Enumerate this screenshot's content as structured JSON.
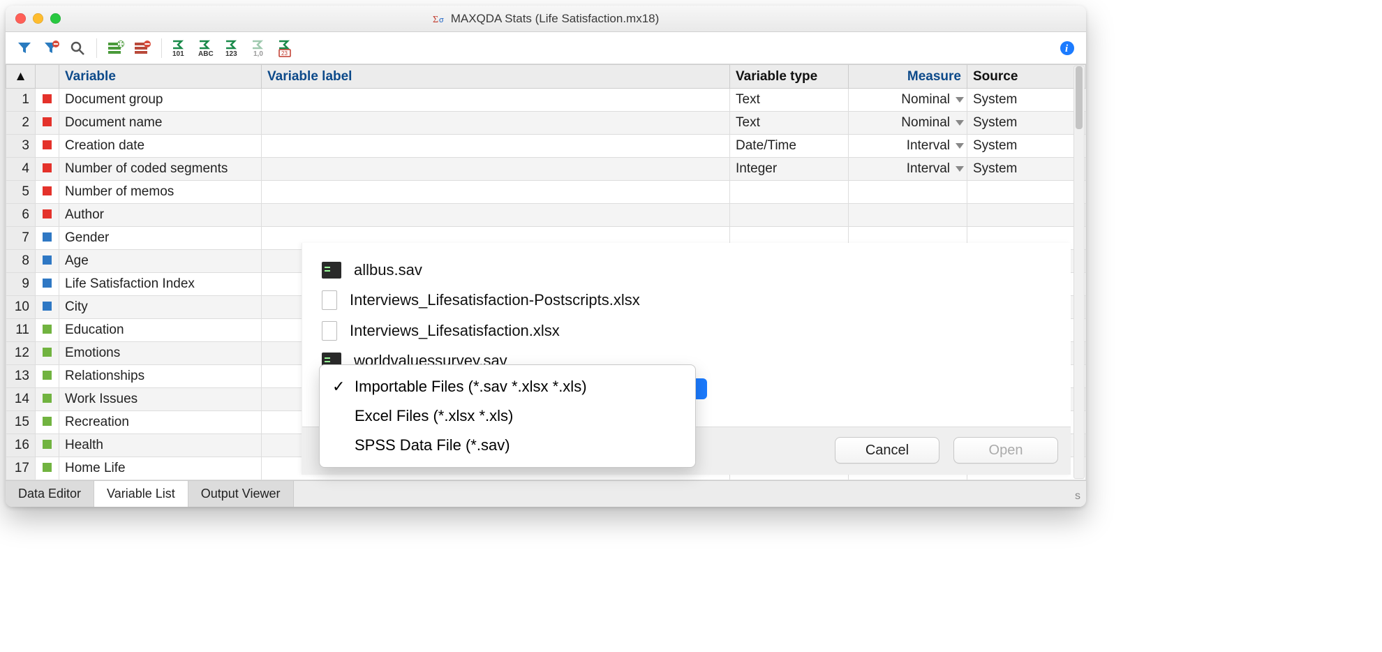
{
  "window": {
    "title": "MAXQDA Stats (Life Satisfaction.mx18)"
  },
  "toolbar": {
    "icons": [
      "filter",
      "filter-remove",
      "search",
      "row-add",
      "row-remove",
      "col-101",
      "col-abc",
      "col-123",
      "col-10",
      "col-date"
    ],
    "info": "info"
  },
  "table": {
    "headers": {
      "variable": "Variable",
      "label": "Variable label",
      "type": "Variable type",
      "measure": "Measure",
      "source": "Source"
    },
    "rows": [
      {
        "n": 1,
        "color": "red",
        "variable": "Document group",
        "label": "",
        "type": "Text",
        "measure": "Nominal",
        "source": "System"
      },
      {
        "n": 2,
        "color": "red",
        "variable": "Document name",
        "label": "",
        "type": "Text",
        "measure": "Nominal",
        "source": "System"
      },
      {
        "n": 3,
        "color": "red",
        "variable": "Creation date",
        "label": "",
        "type": "Date/Time",
        "measure": "Interval",
        "source": "System"
      },
      {
        "n": 4,
        "color": "red",
        "variable": "Number of coded segments",
        "label": "",
        "type": "Integer",
        "measure": "Interval",
        "source": "System"
      },
      {
        "n": 5,
        "color": "red",
        "variable": "Number of memos",
        "label": "",
        "type": "",
        "measure": "",
        "source": ""
      },
      {
        "n": 6,
        "color": "red",
        "variable": "Author",
        "label": "",
        "type": "",
        "measure": "",
        "source": ""
      },
      {
        "n": 7,
        "color": "blue",
        "variable": "Gender",
        "label": "",
        "type": "",
        "measure": "",
        "source": ""
      },
      {
        "n": 8,
        "color": "blue",
        "variable": "Age",
        "label": "",
        "type": "",
        "measure": "",
        "source": ""
      },
      {
        "n": 9,
        "color": "blue",
        "variable": "Life Satisfaction Index",
        "label": "",
        "type": "",
        "measure": "",
        "source": ""
      },
      {
        "n": 10,
        "color": "blue",
        "variable": "City",
        "label": "",
        "type": "",
        "measure": "",
        "source": ""
      },
      {
        "n": 11,
        "color": "green",
        "variable": "Education",
        "label": "",
        "type": "",
        "measure": "",
        "source": ""
      },
      {
        "n": 12,
        "color": "green",
        "variable": "Emotions",
        "label": "",
        "type": "",
        "measure": "",
        "source": ""
      },
      {
        "n": 13,
        "color": "green",
        "variable": "Relationships",
        "label": "",
        "type": "",
        "measure": "",
        "source": ""
      },
      {
        "n": 14,
        "color": "green",
        "variable": "Work Issues",
        "label": "",
        "type": "",
        "measure": "",
        "source": ""
      },
      {
        "n": 15,
        "color": "green",
        "variable": "Recreation",
        "label": "",
        "type": "",
        "measure": "",
        "source": ""
      },
      {
        "n": 16,
        "color": "green",
        "variable": "Health",
        "label": "",
        "type": "",
        "measure": "",
        "source": ""
      },
      {
        "n": 17,
        "color": "green",
        "variable": "Home Life",
        "label": "",
        "type": "",
        "measure": "",
        "source": ""
      }
    ]
  },
  "bottom_tabs": {
    "data_editor": "Data Editor",
    "variable_list": "Variable List",
    "output_viewer": "Output Viewer"
  },
  "file_dialog": {
    "files": [
      {
        "icon": "term",
        "name": "allbus.sav"
      },
      {
        "icon": "doc",
        "name": "Interviews_Lifesatisfaction-Postscripts.xlsx"
      },
      {
        "icon": "doc",
        "name": "Interviews_Lifesatisfaction.xlsx"
      },
      {
        "icon": "term",
        "name": "worldvaluessurvey.sav"
      }
    ],
    "filters": [
      {
        "label": "Importable Files (*.sav *.xlsx *.xls)",
        "checked": true
      },
      {
        "label": "Excel Files (*.xlsx *.xls)",
        "checked": false
      },
      {
        "label": "SPSS Data File (*.sav)",
        "checked": false
      }
    ],
    "cancel": "Cancel",
    "open": "Open"
  },
  "corner": "s"
}
